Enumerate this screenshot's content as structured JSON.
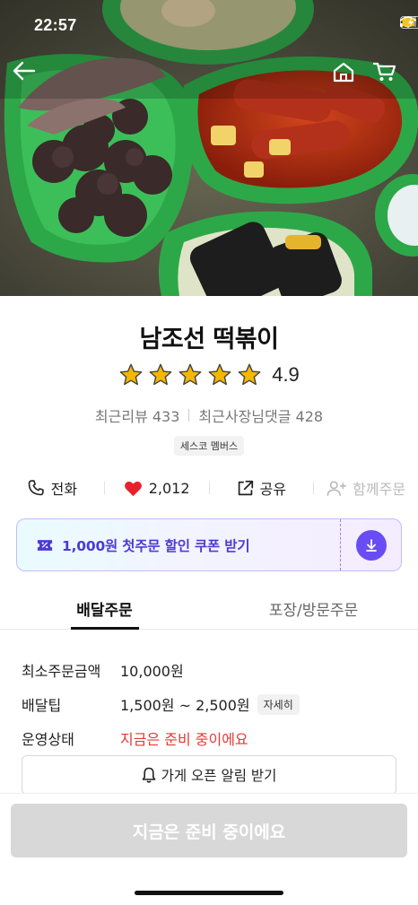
{
  "status_bar": {
    "time": "22:57"
  },
  "store": {
    "name": "남조선 떡볶이",
    "rating": "4.9",
    "stars": 5,
    "recent_reviews": "최근리뷰 433",
    "owner_replies": "최근사장님댓글 428",
    "badge": "세스코 멤버스"
  },
  "actions": {
    "phone": "전화",
    "likes": "2,012",
    "share": "공유",
    "group_order": "함께주문"
  },
  "coupon": {
    "text": "1,000원 첫주문 할인 쿠폰 받기"
  },
  "tabs": [
    {
      "label": "배달주문"
    },
    {
      "label": "포장/방문주문"
    }
  ],
  "order_info": {
    "min_order_label": "최소주문금액",
    "min_order_value": "10,000원",
    "delivery_tip_label": "배달팁",
    "delivery_tip_value": "1,500원 ~ 2,500원",
    "detail_chip": "자세히",
    "status_label": "운영상태",
    "status_value": "지금은 준비 중이에요"
  },
  "alarm_button": "가게 오픈 알림 받기",
  "order_button": "지금은 준비 중이에요",
  "icons": {
    "back": "back-arrow-icon",
    "home": "home-icon",
    "cart": "cart-icon",
    "phone": "phone-icon",
    "heart": "heart-icon",
    "share": "share-icon",
    "group": "add-person-icon",
    "coupon": "coupon-ticket-icon",
    "download": "download-icon",
    "bell": "bell-icon"
  },
  "colors": {
    "accent": "#6a4cf5",
    "warning": "#e53935",
    "heart": "#e8212b",
    "star": "#f5b700"
  }
}
